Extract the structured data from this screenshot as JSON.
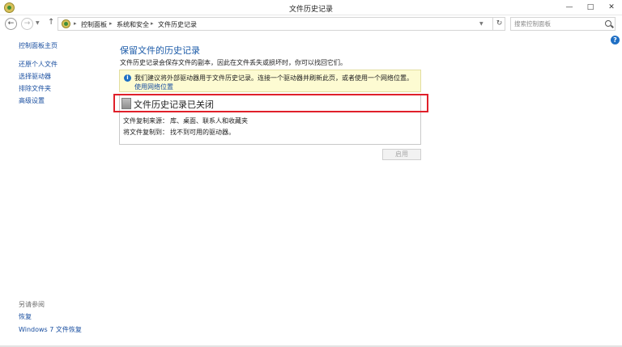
{
  "window": {
    "title": "文件历史记录",
    "minimize_label": "—",
    "maximize_label": "□",
    "close_label": "✕"
  },
  "navigation": {
    "back_label": "←",
    "forward_label": "→",
    "up_label": "↑",
    "breadcrumbs": [
      "控制面板",
      "系统和安全",
      "文件历史记录"
    ],
    "breadcrumb_separator": "▸",
    "refresh_label": "↻",
    "search_placeholder": "搜索控制面板"
  },
  "sidebar": {
    "home_link": "控制面板主页",
    "links": [
      "还原个人文件",
      "选择驱动器",
      "排除文件夹",
      "高级设置"
    ],
    "see_also_label": "另请参阅",
    "see_also_links": [
      "恢复",
      "Windows 7 文件恢复"
    ]
  },
  "main": {
    "title": "保留文件的历史记录",
    "description": "文件历史记录会保存文件的副本，因此在文件丢失或损坏时，你可以找回它们。",
    "info_banner": {
      "text": "我们建议将外部驱动器用于文件历史记录。连接一个驱动器并刷新此页，或者使用一个网络位置。",
      "link": "使用网络位置"
    },
    "status": {
      "title": "文件历史记录已关闭",
      "copy_from_label": "文件复制来源：",
      "copy_from_value": "库、桌面、联系人和收藏夹",
      "copy_to_label": "将文件复制到：",
      "copy_to_value": "找不到可用的驱动器。"
    },
    "enable_button": "启用"
  },
  "colors": {
    "link": "#1a4fa0",
    "title_blue": "#1a5aa8",
    "banner_bg": "#fdfbd2",
    "highlight_red": "#e0202a"
  }
}
